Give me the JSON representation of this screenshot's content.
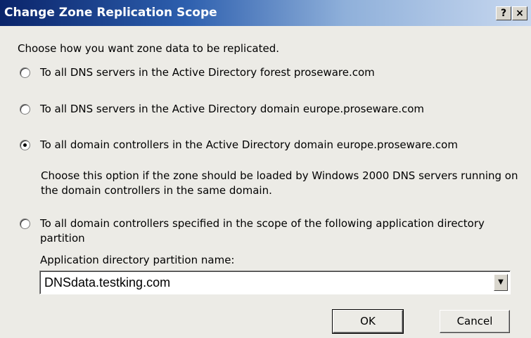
{
  "window": {
    "title": "Change Zone Replication Scope",
    "help_label": "?",
    "close_label": "×"
  },
  "prompt": "Choose how you want zone data to be replicated.",
  "options": [
    {
      "label": "To all DNS servers in the Active Directory forest proseware.com",
      "checked": false
    },
    {
      "label": "To all DNS servers in the Active Directory domain europe.proseware.com",
      "checked": false
    },
    {
      "label": "To all domain controllers in the Active Directory domain europe.proseware.com",
      "checked": true
    },
    {
      "label": "To all domain controllers specified in the scope of the following application directory partition",
      "checked": false
    }
  ],
  "option3_note": "Choose this option if the zone should be loaded by Windows 2000 DNS servers running on the domain controllers in the same domain.",
  "partition": {
    "label": "Application directory partition name:",
    "selected_value": "DNSdata.testking.com",
    "arrow_icon": "▼"
  },
  "buttons": {
    "ok_label": "OK",
    "cancel_label": "Cancel"
  }
}
